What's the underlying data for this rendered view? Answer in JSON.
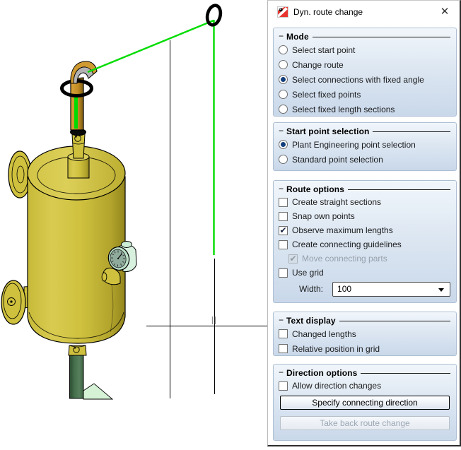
{
  "window": {
    "title": "Dyn. route change",
    "close_glyph": "✕"
  },
  "mode": {
    "title": "Mode",
    "collapse_glyph": "−",
    "options": [
      {
        "label": "Select start point",
        "selected": false
      },
      {
        "label": "Change route",
        "selected": false
      },
      {
        "label": "Select connections with fixed angle",
        "selected": true
      },
      {
        "label": "Select fixed points",
        "selected": false
      },
      {
        "label": "Select fixed length sections",
        "selected": false
      }
    ]
  },
  "start_point": {
    "title": "Start point selection",
    "collapse_glyph": "−",
    "options": [
      {
        "label": "Plant Engineering point selection",
        "selected": true
      },
      {
        "label": "Standard point selection",
        "selected": false
      }
    ]
  },
  "route_options": {
    "title": "Route options",
    "collapse_glyph": "−",
    "checkboxes": [
      {
        "label": "Create straight sections",
        "checked": false,
        "disabled": false
      },
      {
        "label": "Snap own points",
        "checked": false,
        "disabled": false
      },
      {
        "label": "Observe maximum lengths",
        "checked": true,
        "disabled": false
      },
      {
        "label": "Create connecting guidelines",
        "checked": false,
        "disabled": false
      },
      {
        "label": "Move connecting parts",
        "checked": true,
        "disabled": true
      },
      {
        "label": "Use grid",
        "checked": false,
        "disabled": false
      }
    ],
    "width_field": {
      "label": "Width:",
      "value": "100"
    }
  },
  "text_display": {
    "title": "Text display",
    "collapse_glyph": "−",
    "checkboxes": [
      {
        "label": "Changed lengths",
        "checked": false
      },
      {
        "label": "Relative position in grid",
        "checked": false
      }
    ]
  },
  "direction_options": {
    "title": "Direction options",
    "collapse_glyph": "−",
    "checkboxes": [
      {
        "label": "Allow direction changes",
        "checked": false
      }
    ],
    "buttons": [
      {
        "label": "Specify connecting direction",
        "enabled": true
      },
      {
        "label": "Take back route change",
        "enabled": false
      }
    ]
  },
  "colors": {
    "route-green": "#00dc00",
    "vessel-yellow": "#cfc13e",
    "vessel-yellow-dark": "#9a8c20",
    "vessel-yellow-light": "#dcd05a",
    "pipe-orange": "#cf9a31",
    "pipe-green-dark": "#3f6847",
    "mint": "#d8f0de",
    "gauge-face": "#8fab9c",
    "accent-blue-dot": "#123f7c",
    "group-bg-top": "#f1f6fb",
    "group-bg-bottom": "#c9d8ea"
  }
}
